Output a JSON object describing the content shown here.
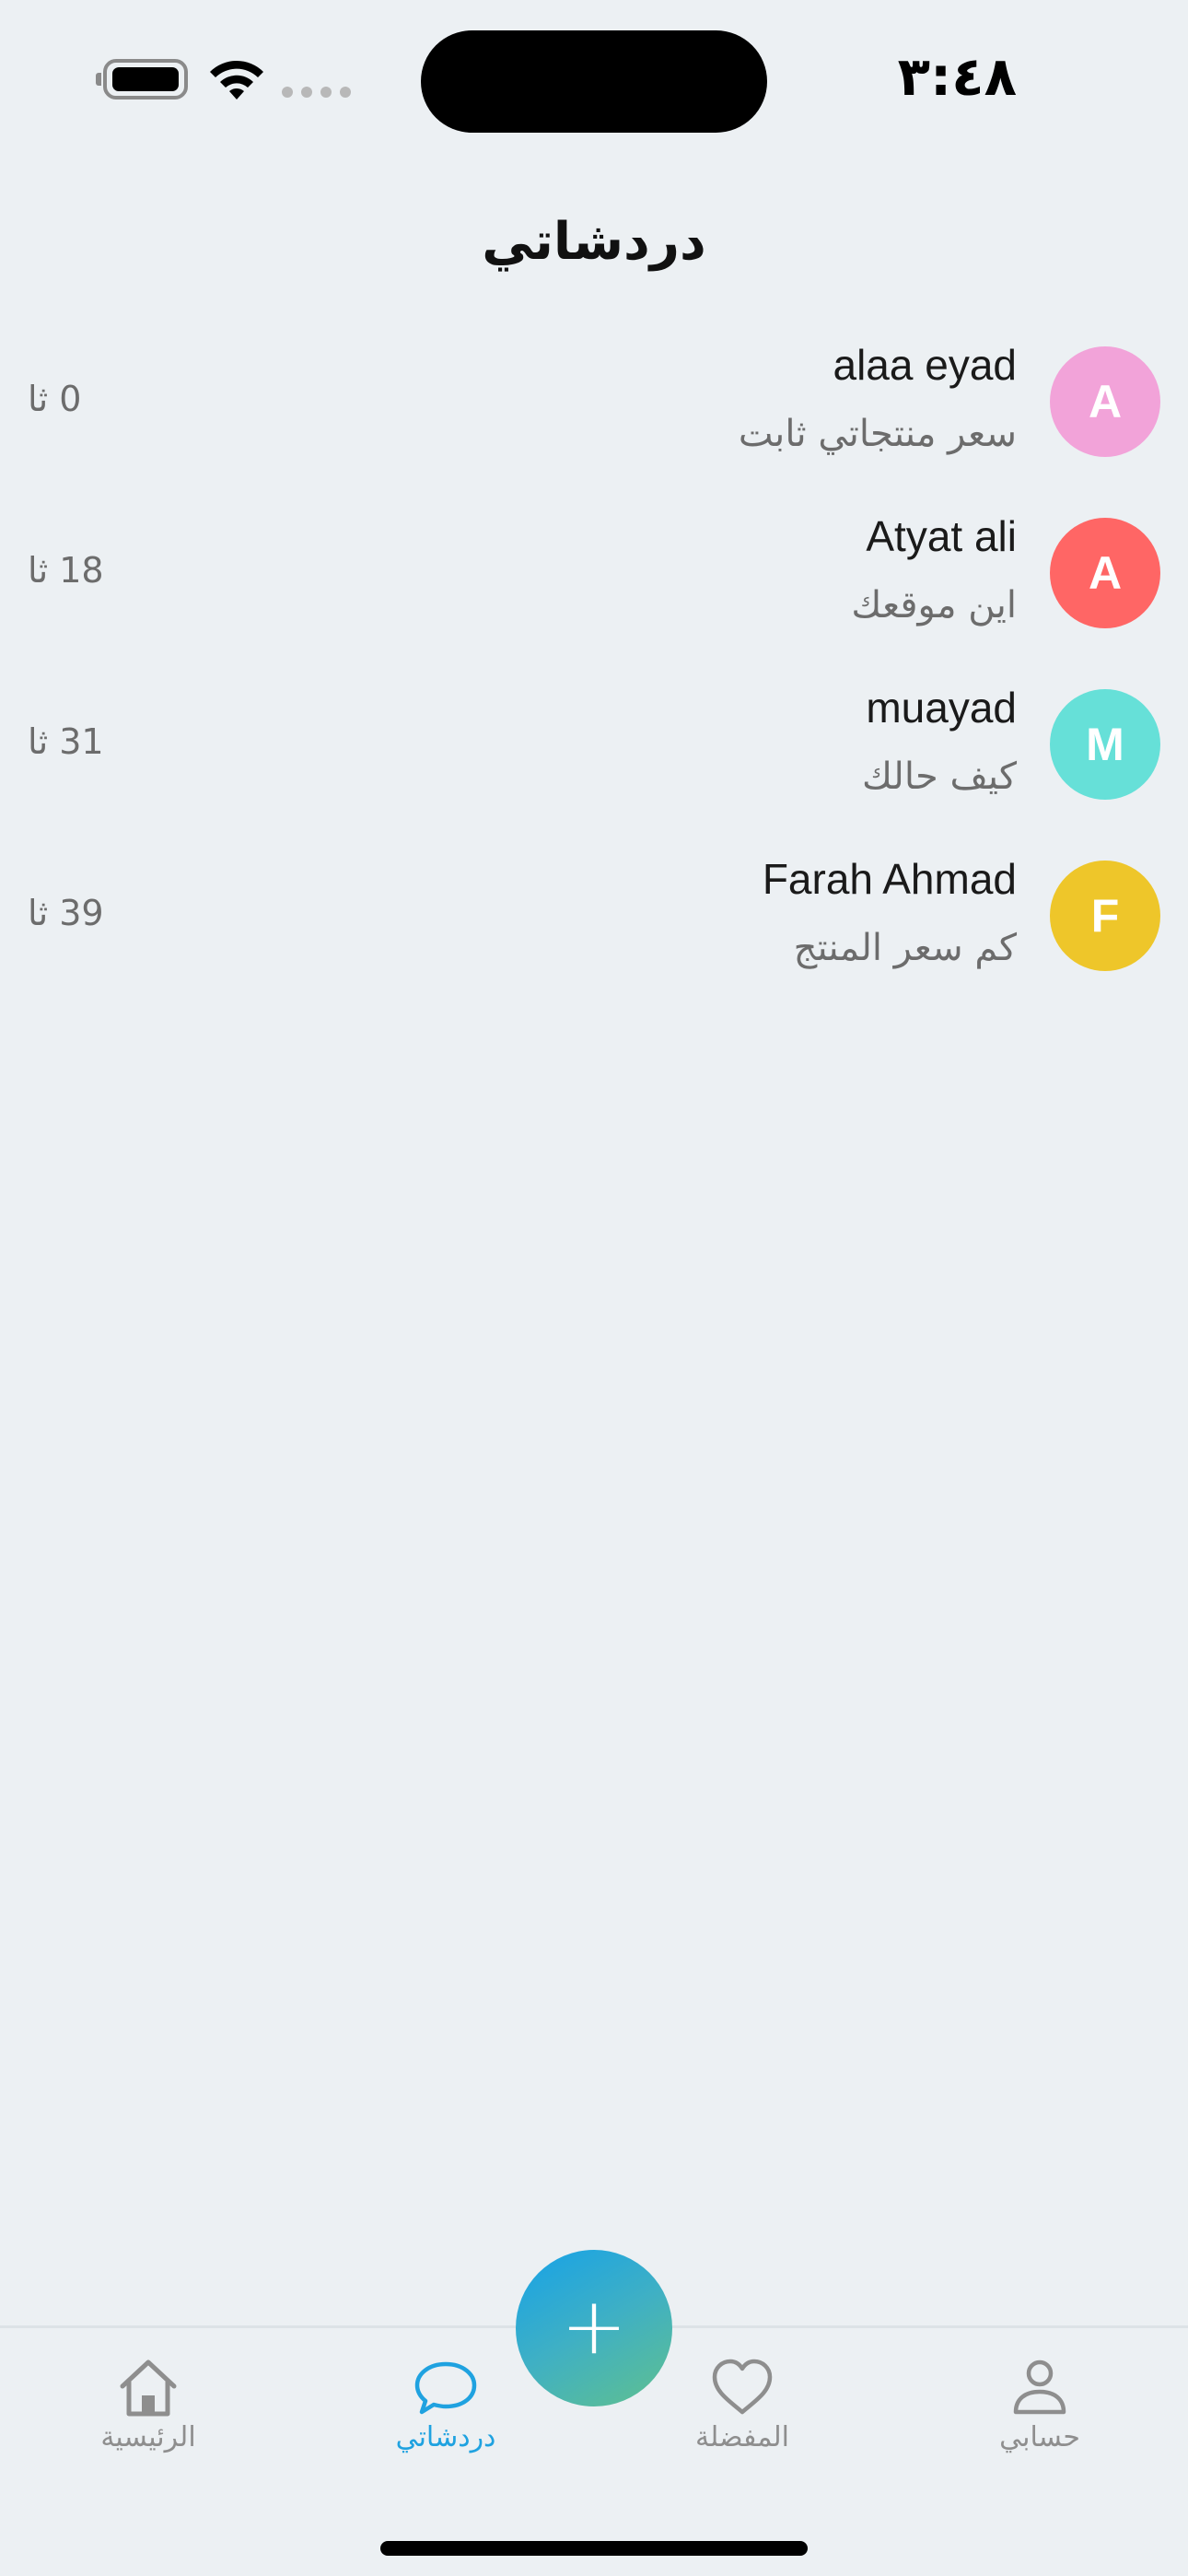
{
  "status_bar": {
    "time": "٣:٤٨",
    "icons": [
      "battery-icon",
      "wifi-icon",
      "signal-icon"
    ]
  },
  "header": {
    "title": "دردشاتي"
  },
  "chats": [
    {
      "initial": "A",
      "name": "alaa eyad",
      "message": "سعر منتجاتي ثابت",
      "time": "0 ثا",
      "color": "#f2a3d9"
    },
    {
      "initial": "A",
      "name": "Atyat ali",
      "message": "اين موقعك",
      "time": "18 ثا",
      "color": "#ff6665"
    },
    {
      "initial": "M",
      "name": "muayad",
      "message": "كيف حالك",
      "time": "31 ثا",
      "color": "#66e0d8"
    },
    {
      "initial": "F",
      "name": "Farah Ahmad",
      "message": "كم سعر المنتج",
      "time": "39 ثا",
      "color": "#eec62a"
    }
  ],
  "fab": {
    "label": "+",
    "icon": "plus-icon"
  },
  "tab_bar": {
    "tabs": [
      {
        "label": "حسابي",
        "icon": "user-icon"
      },
      {
        "label": "المفضلة",
        "icon": "heart-icon"
      },
      {
        "label": "دردشاتي",
        "icon": "chat-bubble-icon",
        "active": true
      },
      {
        "label": "الرئيسية",
        "icon": "home-icon"
      }
    ]
  },
  "colors": {
    "background": "#ecf0f3",
    "accent": "#1fa2e0",
    "inactive": "#8e8e8e"
  }
}
